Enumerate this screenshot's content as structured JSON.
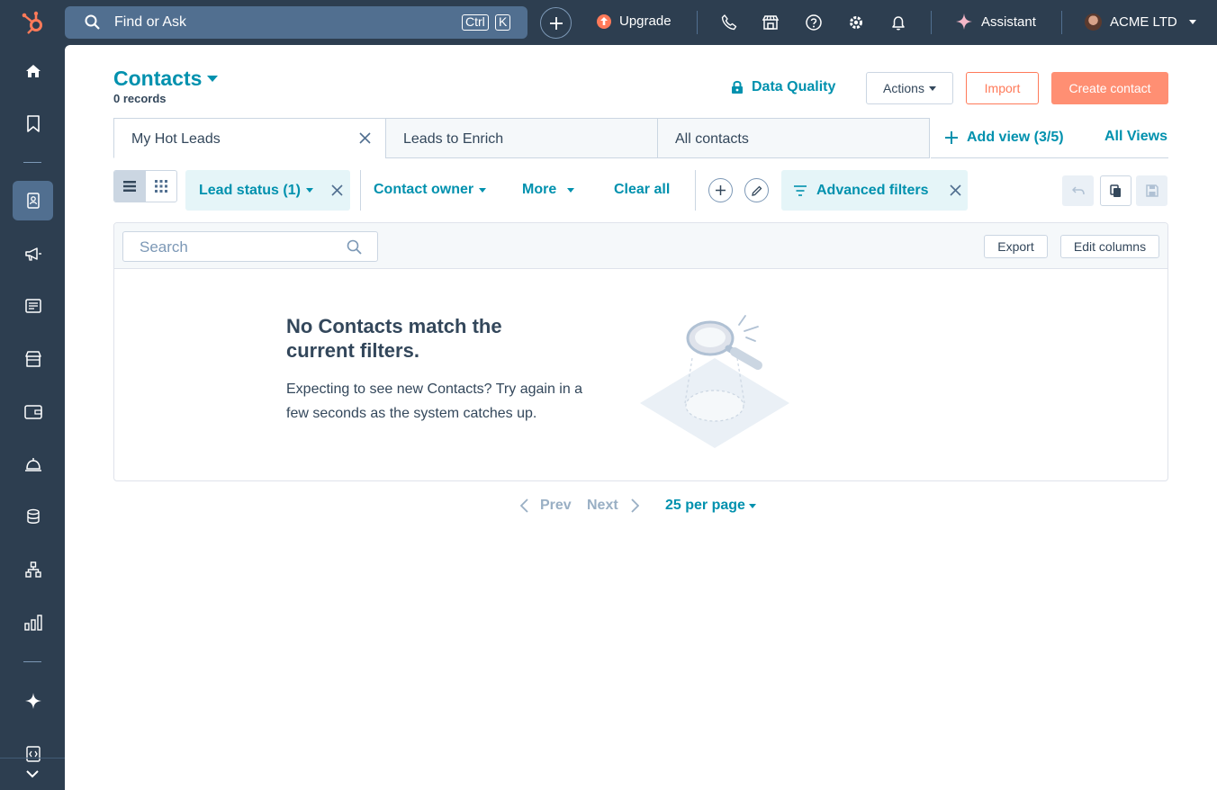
{
  "topbar": {
    "search_text": "Find or Ask",
    "shortcut_keys": [
      "Ctrl",
      "K"
    ],
    "upgrade_label": "Upgrade",
    "assistant_label": "Assistant",
    "account_name": "ACME LTD"
  },
  "sidenav": {
    "items": [
      "home-icon",
      "bookmark-icon",
      "contacts-icon",
      "marketing-icon",
      "content-icon",
      "commerce-icon",
      "payments-icon",
      "service-icon",
      "data-icon",
      "automation-icon",
      "reporting-icon",
      "breeze-icon",
      "developer-icon"
    ],
    "active_item": "contacts-icon"
  },
  "header": {
    "title": "Contacts",
    "record_count": "0 records",
    "data_quality_label": "Data Quality",
    "actions_label": "Actions",
    "import_label": "Import",
    "create_label": "Create contact"
  },
  "views": {
    "tabs": [
      {
        "label": "My Hot Leads",
        "active": true
      },
      {
        "label": "Leads to Enrich",
        "active": false
      },
      {
        "label": "All contacts",
        "active": false
      }
    ],
    "add_view_label": "Add view (3/5)",
    "all_views_label": "All Views"
  },
  "filters": {
    "lead_status_label": "Lead status (1)",
    "contact_owner_label": "Contact owner",
    "more_label": "More",
    "clear_all_label": "Clear all",
    "advanced_filters_label": "Advanced filters"
  },
  "table": {
    "search_placeholder": "Search",
    "export_label": "Export",
    "edit_columns_label": "Edit columns",
    "empty_title": "No Contacts match the current filters.",
    "empty_description": "Expecting to see new Contacts? Try again in a few seconds as the system catches up."
  },
  "pagination": {
    "prev_label": "Prev",
    "next_label": "Next",
    "per_page_label": "25 per page"
  },
  "colors": {
    "nav_bg": "#2d3e50",
    "accent": "#0091ae",
    "primary_cta": "#ff8f73",
    "import_border": "#ff7a59"
  }
}
